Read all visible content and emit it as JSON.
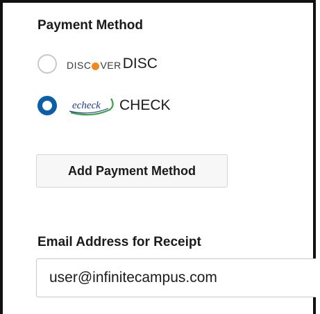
{
  "payment": {
    "title": "Payment Method",
    "options": [
      {
        "logo_text_left": "DISC",
        "logo_text_right": "VER",
        "label": "DISC",
        "selected": false,
        "logo_icon": "discover-logo-icon"
      },
      {
        "logo_text": "echeck",
        "label": "CHECK",
        "selected": true,
        "logo_icon": "echeck-logo-icon"
      }
    ],
    "add_button_label": "Add Payment Method"
  },
  "receipt": {
    "label": "Email Address for Receipt",
    "email_value": "user@infinitecampus.com"
  },
  "colors": {
    "radio_selected": "#0b5ea8",
    "discover_orange": "#f08a1c",
    "echeck_green": "#3aa34a",
    "echeck_blue": "#1f3c8a"
  }
}
